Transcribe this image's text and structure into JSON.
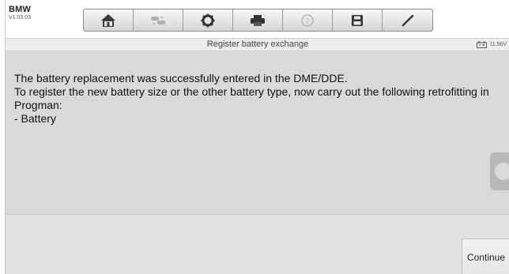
{
  "app": {
    "brand": "BMW",
    "version": "V1.03.03"
  },
  "toolbar": {
    "buttons": [
      {
        "name": "home",
        "icon": "home-icon",
        "enabled": true
      },
      {
        "name": "vehicle-swap",
        "icon": "car-swap-icon",
        "enabled": false
      },
      {
        "name": "settings",
        "icon": "gear-icon",
        "enabled": true
      },
      {
        "name": "print",
        "icon": "printer-icon",
        "enabled": true
      },
      {
        "name": "help",
        "icon": "help-icon",
        "enabled": false
      },
      {
        "name": "save",
        "icon": "floppy-disk-icon",
        "enabled": true
      },
      {
        "name": "edit",
        "icon": "pen-icon",
        "enabled": true
      }
    ]
  },
  "header": {
    "title": "Register battery exchange",
    "battery_voltage": "11.56V"
  },
  "main": {
    "message": "The battery replacement was successfully entered in the DME/DDE.\nTo register the new battery size or the other battery type, now carry out the following retrofitting in Progman:\n- Battery"
  },
  "footer": {
    "continue_label": "Continue"
  },
  "colors": {
    "background": "#d9d9d9",
    "toolbar": "#ffffff",
    "text": "#111111"
  }
}
